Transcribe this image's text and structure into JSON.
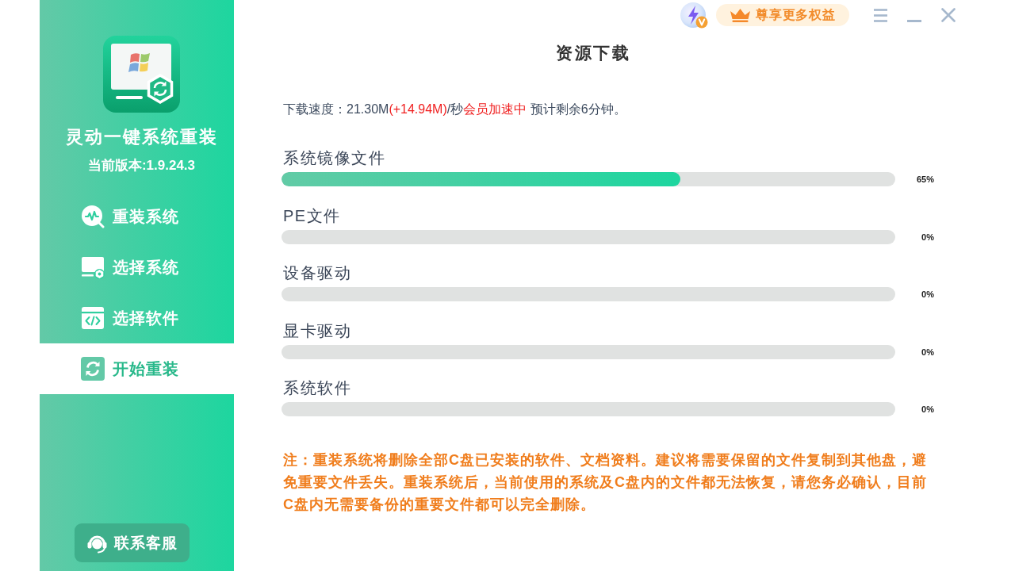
{
  "sidebar": {
    "app_name": "灵动一键系统重装",
    "version": "当前版本:1.9.24.3",
    "items": [
      {
        "label": "重装系统",
        "selected": false
      },
      {
        "label": "选择系统",
        "selected": false
      },
      {
        "label": "选择软件",
        "selected": false
      },
      {
        "label": "开始重装",
        "selected": true
      }
    ],
    "contact_button": "联系客服"
  },
  "top_bar": {
    "vip_button": "尊享更多权益"
  },
  "title": "资源下载",
  "speed": [
    {
      "text": "下载速度：21.30M",
      "highlight": false
    },
    {
      "text": "(+14.94M)",
      "highlight": true
    },
    {
      "text": "/秒",
      "highlight": false
    },
    {
      "text": "会员加速中",
      "highlight": true
    },
    {
      "text": " 预计剩余6分钟。",
      "highlight": false
    }
  ],
  "downloads": [
    {
      "name": "系统镜像文件",
      "level": 0.65,
      "percent": "65%"
    },
    {
      "name": "PE文件",
      "level": 0,
      "percent": "0%"
    },
    {
      "name": "设备驱动",
      "level": 0,
      "percent": "0%"
    },
    {
      "name": "显卡驱动",
      "level": 0,
      "percent": "0%"
    },
    {
      "name": "系统软件",
      "level": 0,
      "percent": "0%"
    }
  ],
  "note": "注：重装系统将删除全部C盘已安装的软件、文档资料。建议将需要保留的文件复制到其他盘，避免重要文件丢失。重装系统后，当前使用的系统及C盘内的文件都无法恢复，请您务必确认，目前C盘内无需要备份的重要文件都可以完全删除。"
}
